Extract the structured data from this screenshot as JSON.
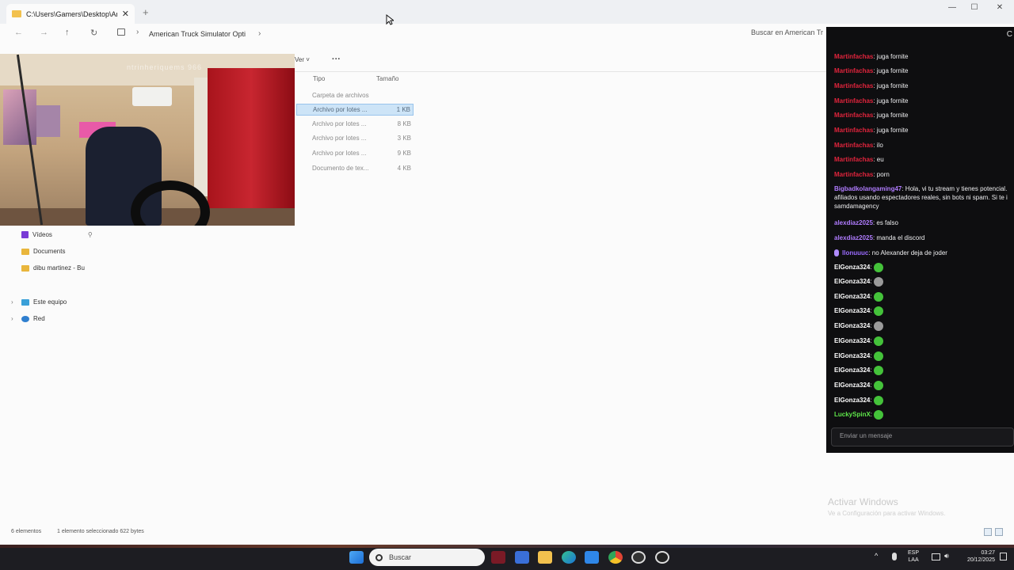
{
  "window": {
    "tab_title": "C:\\Users\\Gamers\\Desktop\\Am",
    "tab_close": "✕",
    "new_tab": "+",
    "minimize": "—",
    "maximize": "☐",
    "close": "✕"
  },
  "navbar": {
    "back": "←",
    "forward": "→",
    "up": "↑",
    "refresh": "↻",
    "breadcrumb": "American Truck Simulator Opti",
    "breadcrumb_chevron": "›",
    "search_placeholder": "Buscar en American Tr"
  },
  "commandbar": {
    "view": "Ver",
    "more": "···"
  },
  "filelist": {
    "headers": {
      "type": "Tipo",
      "size": "Tamaño"
    },
    "rows": [
      {
        "type": "Carpeta de archivos",
        "size": "",
        "selected": false
      },
      {
        "type": "Archivo por lotes ...",
        "size": "1 KB",
        "selected": true
      },
      {
        "type": "Archivo por lotes ...",
        "size": "8 KB",
        "selected": false
      },
      {
        "type": "Archivo por lotes ...",
        "size": "3 KB",
        "selected": false
      },
      {
        "type": "Archivo por lotes ...",
        "size": "9 KB",
        "selected": false
      },
      {
        "type": "Documento de tex...",
        "size": "4 KB",
        "selected": false
      }
    ]
  },
  "sidebar": {
    "items": [
      {
        "label": "Vídeos",
        "icon": "video-icon"
      },
      {
        "label": "Documents",
        "icon": "folder-icon"
      },
      {
        "label": "dibu martinez - Bu",
        "icon": "folder-icon"
      },
      {
        "label": "Este equipo",
        "icon": "computer-icon"
      },
      {
        "label": "Red",
        "icon": "network-icon"
      }
    ]
  },
  "webcam": {
    "watermark": "ntrinheriquems 966"
  },
  "chat": {
    "messages": [
      {
        "user": "Martinfachas",
        "text": ": juga fornite",
        "color": "#e0243c",
        "emote": ""
      },
      {
        "user": "Martinfachas",
        "text": ": juga fornite",
        "color": "#e0243c",
        "emote": ""
      },
      {
        "user": "Martinfachas",
        "text": ": juga fornite",
        "color": "#e0243c",
        "emote": ""
      },
      {
        "user": "Martinfachas",
        "text": ": juga fornite",
        "color": "#e0243c",
        "emote": ""
      },
      {
        "user": "Martinfachas",
        "text": ": juga fornite",
        "color": "#e0243c",
        "emote": ""
      },
      {
        "user": "Martinfachas",
        "text": ": juga fornite",
        "color": "#e0243c",
        "emote": ""
      },
      {
        "user": "Martinfachas",
        "text": ": ilo",
        "color": "#e0243c",
        "emote": ""
      },
      {
        "user": "Martinfachas",
        "text": ": eu",
        "color": "#e0243c",
        "emote": ""
      },
      {
        "user": "Martinfachas",
        "text": ": porn",
        "color": "#e0243c",
        "emote": ""
      },
      {
        "user": "Bigbadkolangaming47",
        "text": ": Hola, vi tu stream y tienes potencial. afiliados usando espectadores reales, sin bots ni spam. Si te i samdamagency",
        "color": "#b07cff",
        "emote": ""
      },
      {
        "user": "alexdiaz2025",
        "text": ": es falso",
        "color": "#b07cff",
        "emote": ""
      },
      {
        "user": "alexdiaz2025",
        "text": ": manda el discord",
        "color": "#b07cff",
        "emote": ""
      },
      {
        "user": "llonuuuc",
        "text": ": no Alexander deja de joder",
        "color": "#9b6bff",
        "emote": ""
      },
      {
        "user": "ElGonza324",
        "text": ":",
        "color": "#ffffff",
        "emote": "green"
      },
      {
        "user": "ElGonza324",
        "text": ":",
        "color": "#ffffff",
        "emote": "gray"
      },
      {
        "user": "ElGonza324",
        "text": ":",
        "color": "#ffffff",
        "emote": "green"
      },
      {
        "user": "ElGonza324",
        "text": ":",
        "color": "#ffffff",
        "emote": "green"
      },
      {
        "user": "ElGonza324",
        "text": ":",
        "color": "#ffffff",
        "emote": "gray"
      },
      {
        "user": "ElGonza324",
        "text": ":",
        "color": "#ffffff",
        "emote": "green"
      },
      {
        "user": "ElGonza324",
        "text": ":",
        "color": "#ffffff",
        "emote": "green"
      },
      {
        "user": "ElGonza324",
        "text": ":",
        "color": "#ffffff",
        "emote": "green"
      },
      {
        "user": "ElGonza324",
        "text": ":",
        "color": "#ffffff",
        "emote": "green"
      },
      {
        "user": "ElGonza324",
        "text": ":",
        "color": "#ffffff",
        "emote": "green"
      },
      {
        "user": "LuckySpinX",
        "text": ":",
        "color": "#5fe84a",
        "emote": "green"
      }
    ],
    "input_placeholder": "Enviar un mensaje",
    "close": "C"
  },
  "activation": {
    "title": "Activar Windows",
    "subtitle": "Ve a Configuración para activar Windows."
  },
  "statusbar": {
    "count": "6 elementos",
    "selected": "1 elemento seleccionado  622 bytes"
  },
  "taskbar": {
    "search": "Buscar",
    "language_top": "ESP",
    "language_bottom": "LAA",
    "time": "03:27",
    "date": "20/12/2025",
    "tray_chevron": "^"
  }
}
